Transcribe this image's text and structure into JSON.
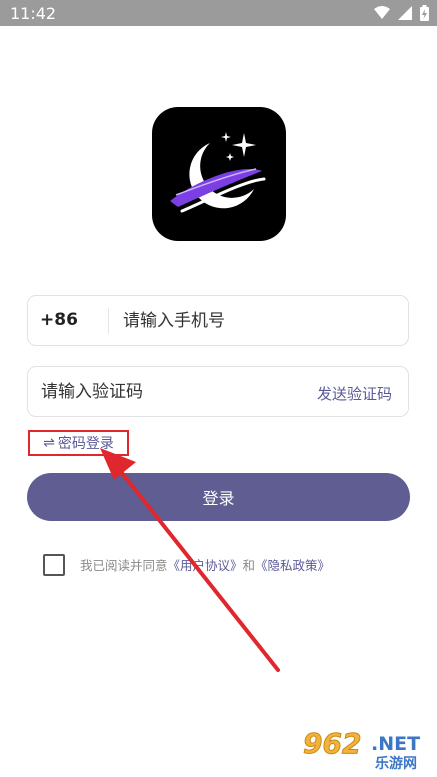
{
  "status_bar": {
    "time": "11:42"
  },
  "phone": {
    "country_code": "+86",
    "placeholder": "请输入手机号"
  },
  "code": {
    "placeholder": "请输入验证码",
    "send_label": "发送验证码"
  },
  "switch_login": {
    "icon": "⇌",
    "label": "密码登录"
  },
  "login_button": {
    "label": "登录"
  },
  "agreement": {
    "prefix": "我已阅读并同意",
    "user_agreement": "《用户协议》",
    "conjunction": "和",
    "privacy_policy": "《隐私政策》"
  },
  "watermark": {
    "number": "962",
    "suffix": ".NET",
    "subtitle": "乐游网"
  },
  "colors": {
    "accent": "#5a5a98",
    "button": "#5f5d92",
    "highlight": "#e0272e"
  }
}
